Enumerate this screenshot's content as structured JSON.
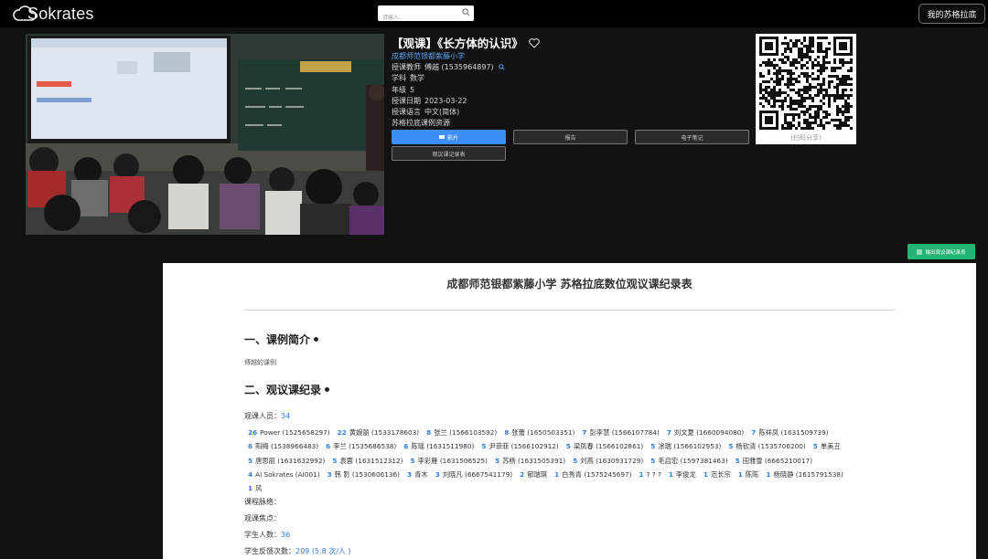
{
  "header": {
    "logo_text": "Sokrates",
    "search_placeholder": "请输入...",
    "my_button": "我的苏格拉底"
  },
  "lesson": {
    "title": "【观课】《长方体的认识》",
    "school": "成都师范银都紫藤小学",
    "teacher_label": "授课教师",
    "teacher_value": "傅越 (1535964897)",
    "subject_label": "学科",
    "subject_value": "数学",
    "grade_label": "年级",
    "grade_value": "5",
    "date_label": "授课日期",
    "date_value": "2023-03-22",
    "language_label": "授课语言",
    "language_value": "中文(简体)",
    "resource_label": "苏格拉底课例资源"
  },
  "buttons": {
    "video": "影片",
    "report": "报告",
    "notes": "电子笔记",
    "observe_record": "观议课记录表"
  },
  "qr": {
    "caption": "(扫码分享)"
  },
  "export_button": "输出观议课纪录表",
  "doc": {
    "title": "成都师范银都紫藤小学 苏格拉底数位观议课纪录表",
    "section1": "一、课例简介",
    "intro": "傅越的课例",
    "section2": "二、观议课纪录",
    "observers_label": "观课人员：",
    "observers_count": "34",
    "observer_rows": [
      [
        {
          "count": "26",
          "name": "Power (1525658297)"
        },
        {
          "count": "22",
          "name": "黄婉丽 (1533178603)"
        },
        {
          "count": "8",
          "name": "张兰 (1566103592)"
        },
        {
          "count": "8",
          "name": "张蕾 (1650503351)"
        },
        {
          "count": "7",
          "name": "彭李慧 (1566107784)"
        },
        {
          "count": "7",
          "name": "刘文夏 (1660094080)"
        },
        {
          "count": "7",
          "name": "陈祥凤 (1631509739)"
        }
      ],
      [
        {
          "count": "6",
          "name": "阳梅 (1538966483)"
        },
        {
          "count": "6",
          "name": "李兰 (1535686538)"
        },
        {
          "count": "6",
          "name": "陈瑶 (1631511980)"
        },
        {
          "count": "5",
          "name": "尹菲菲 (1566102912)"
        },
        {
          "count": "5",
          "name": "梁凤春 (1566102861)"
        },
        {
          "count": "5",
          "name": "凃瑞 (1566102953)"
        },
        {
          "count": "5",
          "name": "杨钦清 (1535706200)"
        },
        {
          "count": "5",
          "name": "单美丑"
        }
      ],
      [
        {
          "count": "5",
          "name": "唐思丽 (1631632992)"
        },
        {
          "count": "5",
          "name": "袁蓉 (1631512312)"
        },
        {
          "count": "5",
          "name": "李彩雁 (1631506525)"
        },
        {
          "count": "5",
          "name": "苏杨 (1631505391)"
        },
        {
          "count": "5",
          "name": "刘燕 (1630931729)"
        },
        {
          "count": "5",
          "name": "毛启宏 (1597381463)"
        },
        {
          "count": "5",
          "name": "田雅雪 (6665210017)"
        }
      ],
      [
        {
          "count": "4",
          "name": "AI Sokrates (AI001)"
        },
        {
          "count": "3",
          "name": "韩 影 (1530606136)"
        },
        {
          "count": "3",
          "name": "青木"
        },
        {
          "count": "3",
          "name": "刘晓凡 (6667541179)"
        },
        {
          "count": "2",
          "name": "郁瑞琪"
        },
        {
          "count": "1",
          "name": "白秀青 (1575245697)"
        },
        {
          "count": "1",
          "name": "? ? ?"
        },
        {
          "count": "1",
          "name": "李俊龙"
        },
        {
          "count": "1",
          "name": "范长宗"
        },
        {
          "count": "1",
          "name": "陈陈"
        },
        {
          "count": "1",
          "name": "杨晓静 (1615791538)"
        }
      ],
      [
        {
          "count": "1",
          "name": "风"
        }
      ]
    ],
    "context_label": "课程脉络：",
    "focus_label": "观课焦点：",
    "students_label": "学生人数：",
    "students_count": "36",
    "feedback_label": "学生反馈次数：",
    "feedback_value": "209 (5.8 次/人 )"
  }
}
